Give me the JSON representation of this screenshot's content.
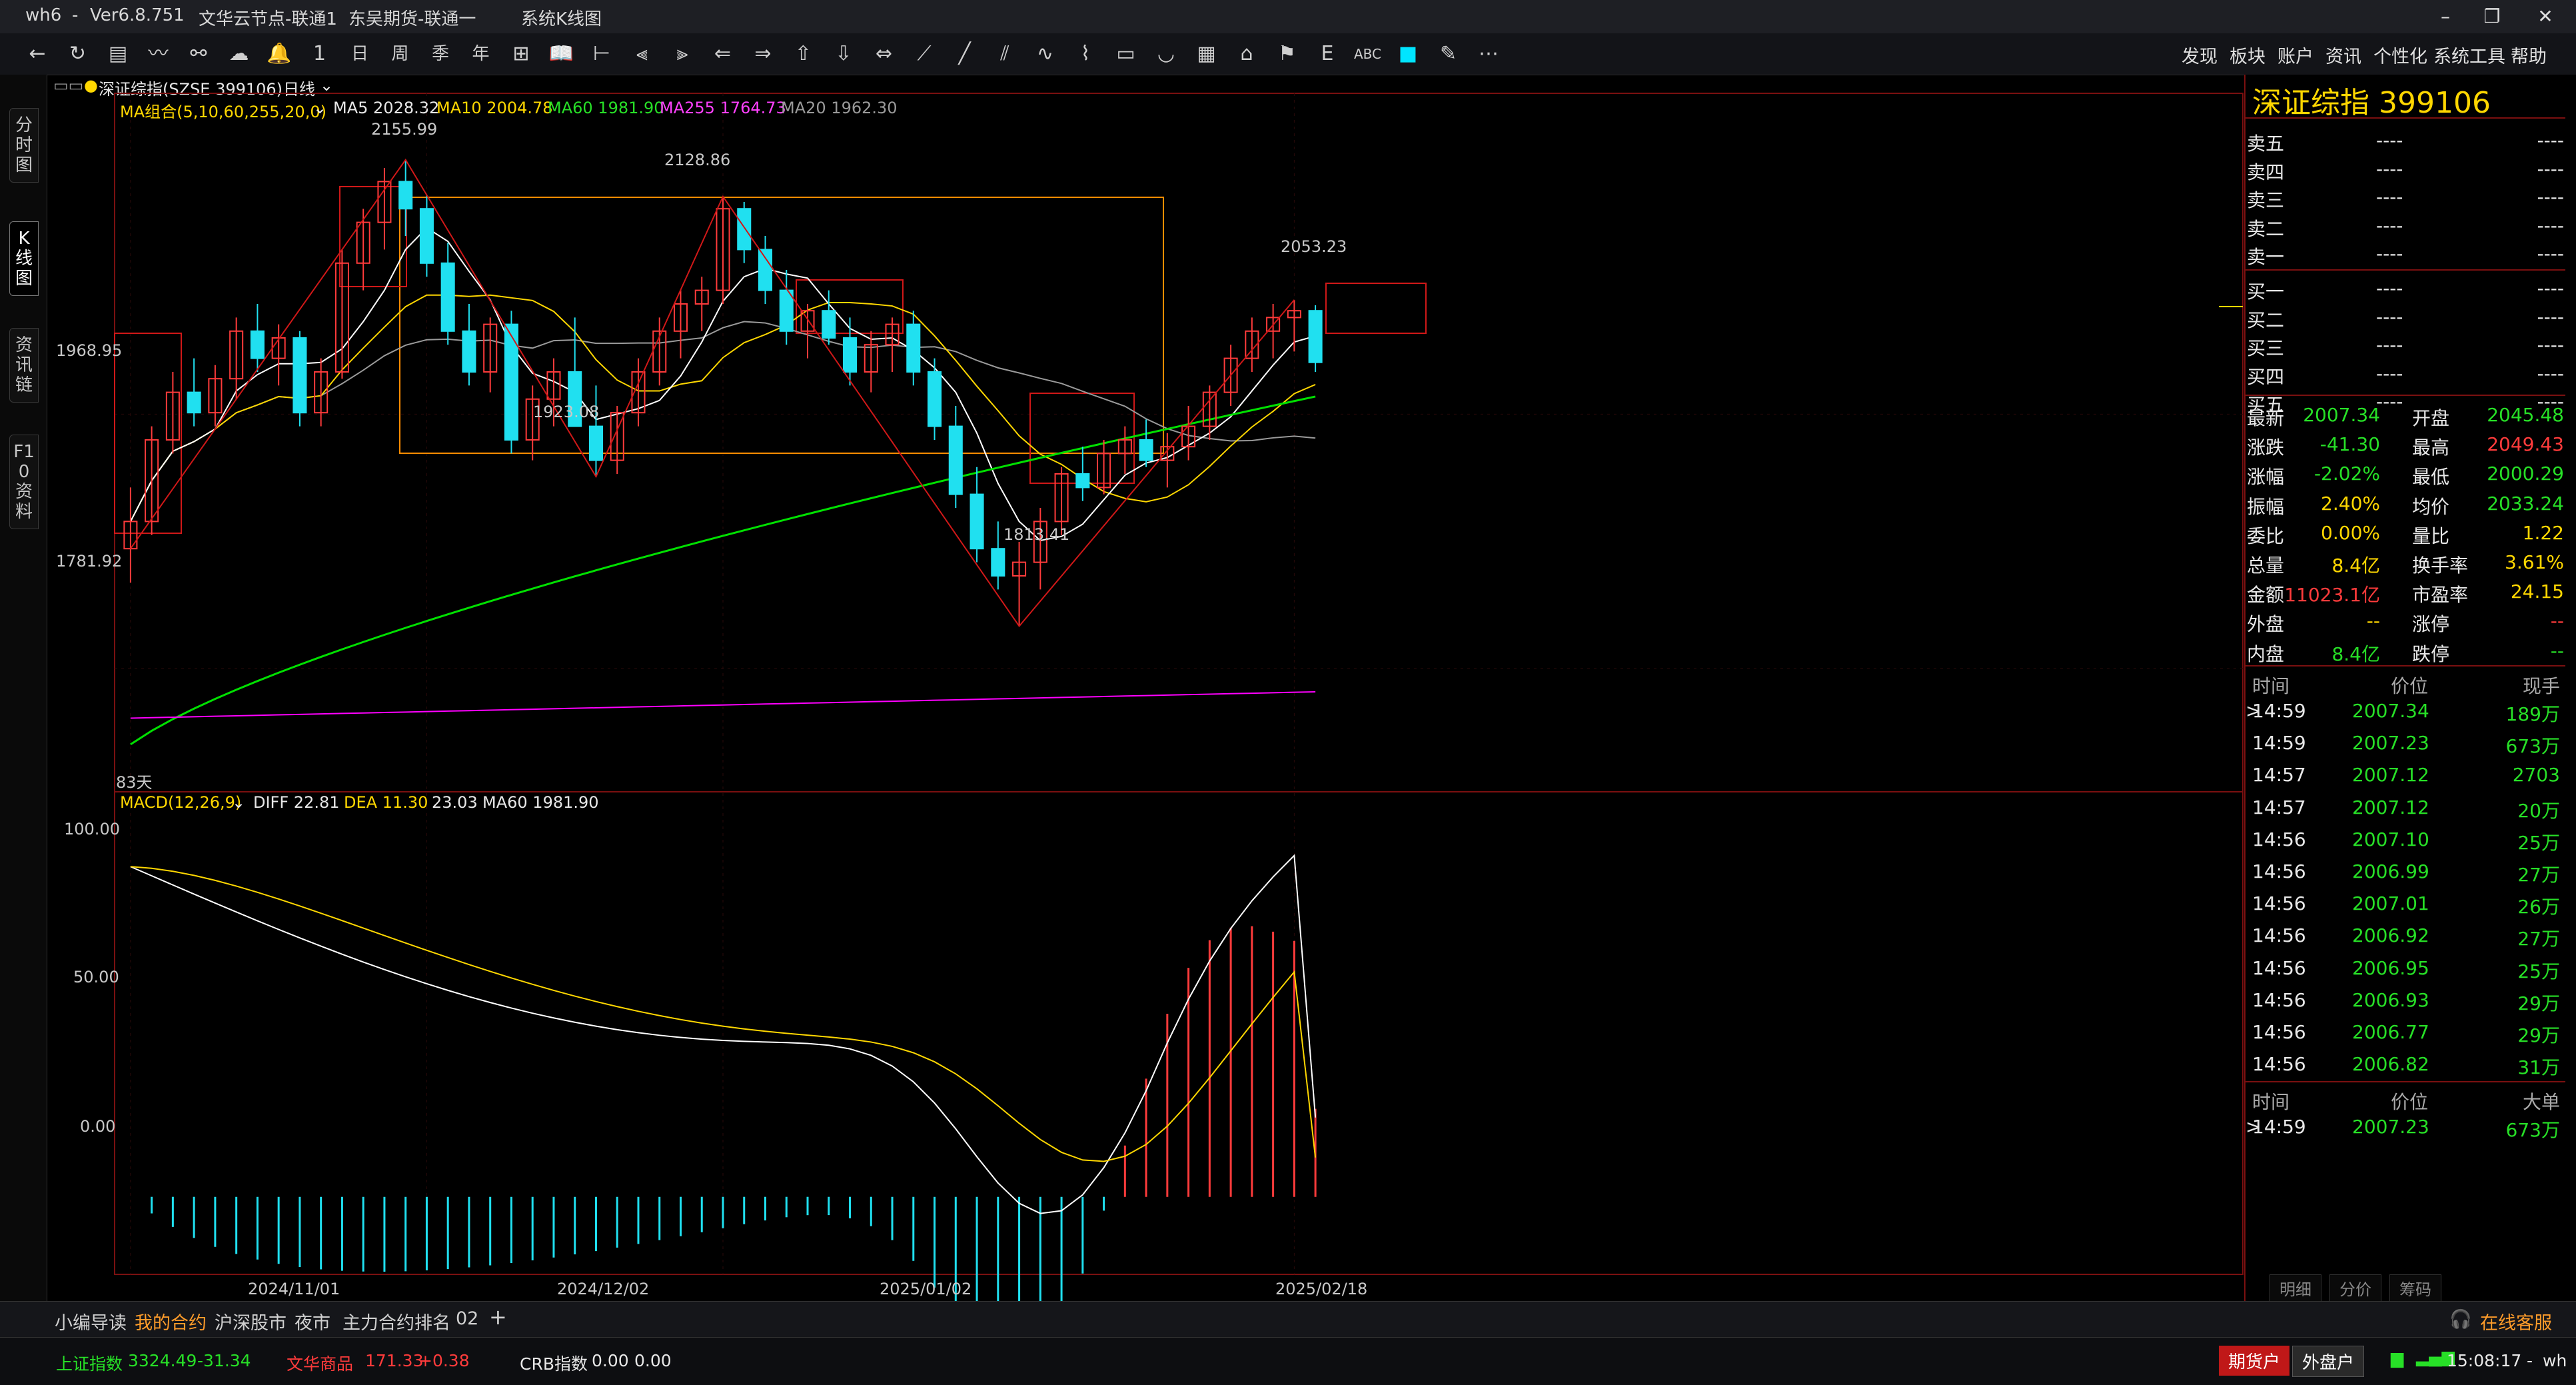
{
  "titlebar": {
    "app": "wh6",
    "sep": "-",
    "version": "Ver6.8.751",
    "node": "文华云节点-联通1",
    "broker": "东吴期货-联通一",
    "view": "系统K线图"
  },
  "window_controls": [
    "–",
    "❐",
    "✕"
  ],
  "menu_right": [
    "发现",
    "板块",
    "账户",
    "资讯",
    "个性化",
    "系统工具",
    "帮助"
  ],
  "toolbar_icons": [
    "back-icon",
    "refresh-icon",
    "grid-icon",
    "line-chart-icon",
    "time-icon",
    "cloud-icon",
    "bell-icon",
    "minute-icon",
    "day-icon",
    "week-icon",
    "season-icon",
    "year-icon",
    "period-icon",
    "book-icon",
    "ruler-icon",
    "zoom-out-icon",
    "zoom-in-icon",
    "arrow-left-icon",
    "arrow-right-icon",
    "up-icon",
    "down-icon",
    "cursor-icon",
    "draw-line-icon",
    "line-icon",
    "parallel-icon",
    "wave-icon",
    "zigzag-icon",
    "box-icon",
    "arc-icon",
    "fib-icon",
    "house-icon",
    "flag-icon",
    "letter-e-icon",
    "abc-icon",
    "color-square-icon",
    "eraser-icon",
    "more-icon"
  ],
  "left_tabs": [
    "分时图",
    "K线图",
    "资讯链",
    "F10资料"
  ],
  "chart_header": {
    "symbol_line": "深证综指(SZSE 399106)",
    "period": "日线",
    "ma_group": "MA组合(5,10,60,255,20,0)",
    "ma5": "MA5 2028.32",
    "ma10": "MA10 2004.78",
    "ma60": "MA60 1981.90",
    "ma255": "MA255 1764.73",
    "ma20": "MA20 1962.30"
  },
  "price_axis": [
    "1968.95",
    "1781.92"
  ],
  "annotations": {
    "high1": "2155.99",
    "high2": "2128.86",
    "high3": "2053.23",
    "low1": "1923.08",
    "low2": "1813.41",
    "days": "83天"
  },
  "macd_header": {
    "name": "MACD(12,26,9)",
    "diff": "DIFF 22.81",
    "dea": "DEA 11.30",
    "macd": "23.03",
    "ma60": "MA60 1981.90"
  },
  "macd_axis": [
    "100.00",
    "50.00",
    "0.00"
  ],
  "date_axis": [
    "2024/11/01",
    "2024/12/02",
    "2025/01/02",
    "2025/02/18"
  ],
  "quote": {
    "name": "深证综指",
    "code": "399106",
    "sell": [
      {
        "label": "卖五",
        "price": "----",
        "vol": "----"
      },
      {
        "label": "卖四",
        "price": "----",
        "vol": "----"
      },
      {
        "label": "卖三",
        "price": "----",
        "vol": "----"
      },
      {
        "label": "卖二",
        "price": "----",
        "vol": "----"
      },
      {
        "label": "卖一",
        "price": "----",
        "vol": "----"
      }
    ],
    "buy": [
      {
        "label": "买一",
        "price": "----",
        "vol": "----"
      },
      {
        "label": "买二",
        "price": "----",
        "vol": "----"
      },
      {
        "label": "买三",
        "price": "----",
        "vol": "----"
      },
      {
        "label": "买四",
        "price": "----",
        "vol": "----"
      },
      {
        "label": "买五",
        "price": "----",
        "vol": "----"
      }
    ],
    "stats": [
      {
        "l1": "最新",
        "v1": "2007.34",
        "c1": "green",
        "l2": "开盘",
        "v2": "2045.48",
        "c2": "green"
      },
      {
        "l1": "涨跌",
        "v1": "-41.30",
        "c1": "green",
        "l2": "最高",
        "v2": "2049.43",
        "c2": "red"
      },
      {
        "l1": "涨幅",
        "v1": "-2.02%",
        "c1": "green",
        "l2": "最低",
        "v2": "2000.29",
        "c2": "green"
      },
      {
        "l1": "振幅",
        "v1": "2.40%",
        "c1": "yellow",
        "l2": "均价",
        "v2": "2033.24",
        "c2": "green"
      },
      {
        "l1": "委比",
        "v1": "0.00%",
        "c1": "yellow",
        "l2": "量比",
        "v2": "1.22",
        "c2": "yellow"
      },
      {
        "l1": "总量",
        "v1": "8.4亿",
        "c1": "yellow",
        "l2": "换手率",
        "v2": "3.61%",
        "c2": "yellow"
      },
      {
        "l1": "金额",
        "v1": "11023.1亿",
        "c1": "red",
        "l2": "市盈率",
        "v2": "24.15",
        "c2": "yellow"
      },
      {
        "l1": "外盘",
        "v1": "--",
        "c1": "yellow",
        "l2": "涨停",
        "v2": "--",
        "c2": "red"
      },
      {
        "l1": "内盘",
        "v1": "8.4亿",
        "c1": "green",
        "l2": "跌停",
        "v2": "--",
        "c2": "green"
      }
    ],
    "ticks_header": {
      "time": "时间",
      "price": "价位",
      "vol": "现手"
    },
    "ticks": [
      {
        "time": "14:59",
        "price": "2007.34",
        "vol": "189万",
        "mark": ">"
      },
      {
        "time": "14:59",
        "price": "2007.23",
        "vol": "673万",
        "mark": ""
      },
      {
        "time": "14:57",
        "price": "2007.12",
        "vol": "2703",
        "mark": ""
      },
      {
        "time": "14:57",
        "price": "2007.12",
        "vol": "20万",
        "mark": ""
      },
      {
        "time": "14:56",
        "price": "2007.10",
        "vol": "25万",
        "mark": ""
      },
      {
        "time": "14:56",
        "price": "2006.99",
        "vol": "27万",
        "mark": ""
      },
      {
        "time": "14:56",
        "price": "2007.01",
        "vol": "26万",
        "mark": ""
      },
      {
        "time": "14:56",
        "price": "2006.92",
        "vol": "27万",
        "mark": ""
      },
      {
        "time": "14:56",
        "price": "2006.95",
        "vol": "25万",
        "mark": ""
      },
      {
        "time": "14:56",
        "price": "2006.93",
        "vol": "29万",
        "mark": ""
      },
      {
        "time": "14:56",
        "price": "2006.77",
        "vol": "29万",
        "mark": ""
      },
      {
        "time": "14:56",
        "price": "2006.82",
        "vol": "31万",
        "mark": ""
      }
    ],
    "big_header": {
      "time": "时间",
      "price": "价位",
      "vol": "大单"
    },
    "big": [
      {
        "time": "14:59",
        "price": "2007.23",
        "vol": "673万",
        "mark": ">"
      }
    ],
    "mini_tabs": [
      "明细",
      "分价",
      "筹码"
    ]
  },
  "bottom_tabs": [
    "小编导读",
    "我的合约",
    "沪深股市",
    "夜市",
    "主力合约排名",
    "02",
    "+"
  ],
  "online_service": "在线客服",
  "status": {
    "sh_name": "上证指数",
    "sh_val": "3324.49",
    "sh_chg": "-31.34",
    "wh_name": "文华商品",
    "wh_val": "171.33",
    "wh_chg": "+0.38",
    "crb_name": "CRB指数",
    "crb_val": "0.00",
    "crb_chg": "0.00",
    "btn1": "期货户",
    "btn2": "外盘户",
    "clock": "15:08:17",
    "user": "wh"
  },
  "colors": {
    "up": "#ff3b3b",
    "down": "#20e0f0",
    "ma5": "#ffffff",
    "ma10": "#ffd700",
    "ma60": "#00e000",
    "ma255": "#ff00ff",
    "ma20": "#9a9a9a",
    "box": "#ff8c00"
  },
  "chart_data": {
    "type": "candlestick",
    "title": "深证综指(SZSE 399106)",
    "period": "日线",
    "x": [
      "2024/11/01",
      "2024/12/02",
      "2025/01/02",
      "2025/02/18"
    ],
    "ohlc": [
      [
        1870,
        1915,
        1845,
        1890
      ],
      [
        1890,
        1960,
        1880,
        1950
      ],
      [
        1950,
        2000,
        1940,
        1985
      ],
      [
        1985,
        2010,
        1960,
        1970
      ],
      [
        1970,
        2005,
        1960,
        1995
      ],
      [
        1995,
        2040,
        1980,
        2030
      ],
      [
        2030,
        2050,
        2000,
        2010
      ],
      [
        2010,
        2035,
        1990,
        2025
      ],
      [
        2025,
        2030,
        1960,
        1970
      ],
      [
        1970,
        2010,
        1960,
        2000
      ],
      [
        2000,
        2090,
        1995,
        2080
      ],
      [
        2080,
        2120,
        2060,
        2110
      ],
      [
        2110,
        2150,
        2090,
        2140
      ],
      [
        2140,
        2156,
        2100,
        2120
      ],
      [
        2120,
        2130,
        2070,
        2080
      ],
      [
        2080,
        2095,
        2020,
        2030
      ],
      [
        2030,
        2050,
        1990,
        2000
      ],
      [
        2000,
        2040,
        1985,
        2035
      ],
      [
        2035,
        2045,
        1940,
        1950
      ],
      [
        1950,
        1990,
        1935,
        1980
      ],
      [
        1980,
        2010,
        1960,
        2000
      ],
      [
        2000,
        2040,
        1990,
        1960
      ],
      [
        1960,
        1990,
        1923,
        1935
      ],
      [
        1935,
        1975,
        1925,
        1970
      ],
      [
        1970,
        2010,
        1960,
        2000
      ],
      [
        2000,
        2040,
        1990,
        2030
      ],
      [
        2030,
        2060,
        2010,
        2050
      ],
      [
        2050,
        2070,
        2030,
        2060
      ],
      [
        2060,
        2129,
        2050,
        2120
      ],
      [
        2120,
        2125,
        2080,
        2090
      ],
      [
        2090,
        2100,
        2050,
        2060
      ],
      [
        2060,
        2075,
        2020,
        2030
      ],
      [
        2030,
        2050,
        2010,
        2045
      ],
      [
        2045,
        2060,
        2020,
        2025
      ],
      [
        2025,
        2040,
        1990,
        2000
      ],
      [
        2000,
        2030,
        1985,
        2020
      ],
      [
        2020,
        2040,
        2000,
        2035
      ],
      [
        2035,
        2045,
        1990,
        2000
      ],
      [
        2000,
        2010,
        1950,
        1960
      ],
      [
        1960,
        1975,
        1900,
        1910
      ],
      [
        1910,
        1930,
        1860,
        1870
      ],
      [
        1870,
        1890,
        1840,
        1850
      ],
      [
        1850,
        1875,
        1813,
        1860
      ],
      [
        1860,
        1900,
        1840,
        1890
      ],
      [
        1890,
        1930,
        1880,
        1925
      ],
      [
        1925,
        1945,
        1905,
        1915
      ],
      [
        1915,
        1950,
        1910,
        1940
      ],
      [
        1940,
        1960,
        1925,
        1950
      ],
      [
        1950,
        1965,
        1930,
        1935
      ],
      [
        1935,
        1955,
        1915,
        1945
      ],
      [
        1945,
        1975,
        1935,
        1960
      ],
      [
        1960,
        1990,
        1950,
        1985
      ],
      [
        1985,
        2020,
        1975,
        2010
      ],
      [
        2010,
        2040,
        2000,
        2030
      ],
      [
        2030,
        2050,
        2010,
        2040
      ],
      [
        2040,
        2053,
        2015,
        2045
      ],
      [
        2045,
        2049,
        2000,
        2007
      ]
    ],
    "series": [
      {
        "name": "MA5",
        "last": 2028.32
      },
      {
        "name": "MA10",
        "last": 2004.78
      },
      {
        "name": "MA60",
        "last": 1981.9
      },
      {
        "name": "MA255",
        "last": 1764.73
      },
      {
        "name": "MA20",
        "last": 1962.3
      }
    ],
    "macd": {
      "diff": 22.81,
      "dea": 11.3,
      "macd": 23.03,
      "ylim": [
        -20,
        110
      ]
    },
    "ylim": [
      1700,
      2200
    ],
    "annotations": [
      "2155.99",
      "2128.86",
      "2053.23",
      "1923.08",
      "1813.41"
    ]
  }
}
